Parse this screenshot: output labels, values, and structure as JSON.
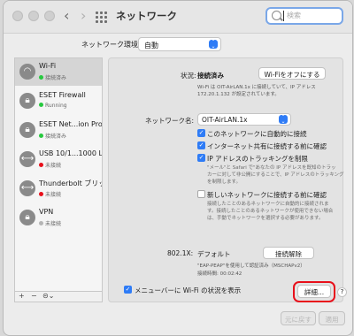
{
  "window": {
    "title": "ネットワーク"
  },
  "search": {
    "placeholder": "検索"
  },
  "env": {
    "label": "ネットワーク環境:",
    "value": "自動"
  },
  "sidebar": {
    "items": [
      {
        "name": "Wi-Fi",
        "status": "接続済み",
        "status_color": "#27c93f",
        "icon": "wifi-icon"
      },
      {
        "name": "ESET Firewall",
        "status": "Running",
        "status_color": "#27c93f",
        "icon": "lock-icon"
      },
      {
        "name": "ESET Net...ion Proxy",
        "status": "接続済み",
        "status_color": "#27c93f",
        "icon": "lock-icon"
      },
      {
        "name": "USB 10/1...1000 LAN",
        "status": "未接続",
        "status_color": "#e8101b",
        "icon": "ethernet-icon"
      },
      {
        "name": "Thunderbolt ブリッジ",
        "status": "未接続",
        "status_color": "#e8101b",
        "icon": "thunderbolt-bridge-icon"
      },
      {
        "name": "VPN",
        "status": "未接続",
        "status_color": "#b5b5b5",
        "icon": "vpn-lock-icon"
      }
    ],
    "tools": {
      "add": "+",
      "remove": "−",
      "action": "⊝⌄"
    }
  },
  "detail": {
    "status_label": "状況:",
    "status_value": "接続済み",
    "wifi_off_button": "Wi-Fiをオフにする",
    "status_desc_1": "Wi-Fi は OIT-AirLAN.1x に接続していて、IP アドレス",
    "status_desc_2": "172.20.1.132 が設定されています。",
    "network_name_label": "ネットワーク名:",
    "network_name_value": "OIT-AirLAN.1x",
    "checkboxes": [
      {
        "label": "このネットワークに自動的に接続",
        "checked": true
      },
      {
        "label": "インターネット共有に接続する前に確認",
        "checked": true
      },
      {
        "label": "IP アドレスのトラッキングを制限",
        "checked": true
      }
    ],
    "tracking_desc": [
      "\"メール\"と Safari で\"あなたの IP アドレスを既知のトラッ",
      "カーに対して非公開にすることで、IP アドレスのトラッキング",
      "を制限します。"
    ],
    "ask_new": {
      "label": "新しいネットワークに接続する前に確認",
      "checked": false
    },
    "ask_desc": [
      "接続したことのあるネットワークに自動的に接続されま",
      "す。接続したことのあるネットワークが使用できない場合",
      "は、手動でネットワークを選択する必要があります。"
    ],
    "x8021_label": "802.1X:",
    "x8021_value": "デフォルト",
    "disconnect_button": "接続解除",
    "auth_line": "\"EAP-PEAP\"を使用して認証済み（MSCHAPv2）",
    "conn_time_label": "接続時間:",
    "conn_time_value": "00:02:42"
  },
  "footer": {
    "menubar_label": "メニューバーに Wi-Fi の状況を表示",
    "menubar_checked": true,
    "advanced_button": "詳細...",
    "help_button": "?",
    "revert_button": "元に戻す",
    "apply_button": "適用"
  },
  "colors": {
    "accent": "#2f7cf6",
    "highlight": "#e8101b"
  }
}
